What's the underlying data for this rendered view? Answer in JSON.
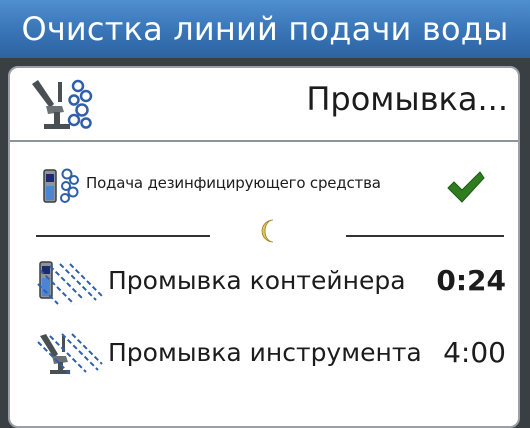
{
  "window": {
    "title": "Очистка линий подачи воды"
  },
  "header": {
    "status_label": "Промывка...",
    "icon": "chair-rinse-icon"
  },
  "disinfectant": {
    "label": "Подача дезинфицирующего средства",
    "icon": "bottle-bubbles-icon",
    "status_icon": "checkmark-icon",
    "status_color": "#2e7d1e"
  },
  "divider": {
    "icon": "moon-icon"
  },
  "steps": [
    {
      "label": "Промывка контейнера",
      "time": "0:24",
      "icon": "container-rinse-icon",
      "active": true
    },
    {
      "label": "Промывка инструмента",
      "time": "4:00",
      "icon": "instrument-rinse-icon",
      "active": false
    }
  ],
  "colors": {
    "title_bar": "#3874b6",
    "icon_blue": "#2f5fa8",
    "moon": "#e2c85a"
  }
}
